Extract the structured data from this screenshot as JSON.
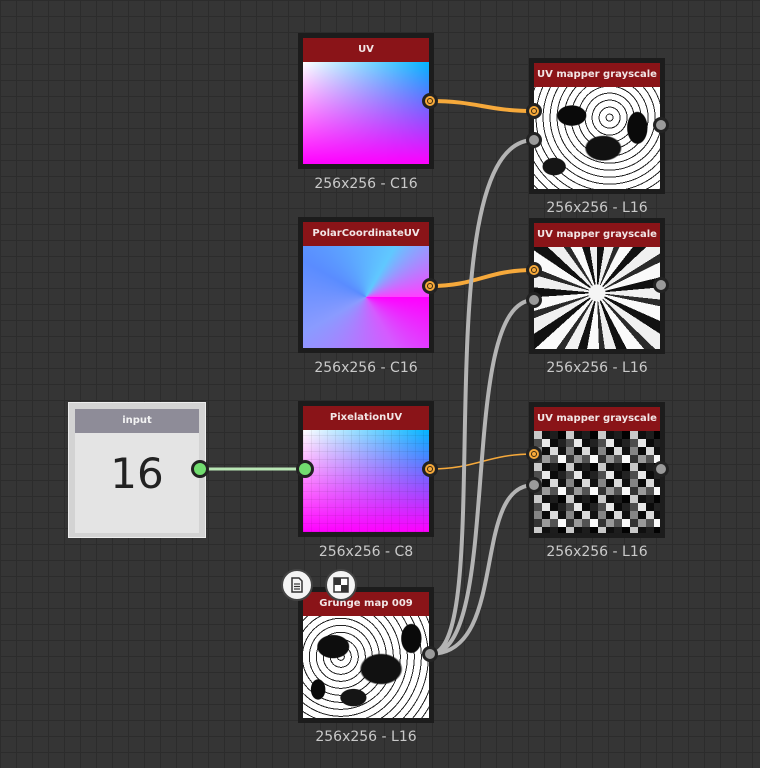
{
  "nodes": {
    "uv": {
      "title": "UV",
      "caption": "256x256 - C16"
    },
    "polar": {
      "title": "PolarCoordinateUV",
      "caption": "256x256 - C16"
    },
    "pixelation": {
      "title": "PixelationUV",
      "caption": "256x256 - C8"
    },
    "grunge": {
      "title": "Grunge map 009",
      "caption": "256x256 - L16"
    },
    "mapper1": {
      "title": "UV mapper grayscale",
      "caption": "256x256 - L16"
    },
    "mapper2": {
      "title": "UV mapper grayscale",
      "caption": "256x256 - L16"
    },
    "mapper3": {
      "title": "UV mapper grayscale",
      "caption": "256x256 - L16"
    }
  },
  "input_node": {
    "title": "input",
    "value": "16"
  },
  "icons": {
    "document": "document-icon",
    "checker": "checkerboard-icon"
  },
  "colors": {
    "node_header": "#8a1418",
    "wire_orange": "#f6a93b",
    "wire_gray": "#b4b4b4",
    "wire_green": "#b9e6b5",
    "port_green": "#71dd6f"
  }
}
